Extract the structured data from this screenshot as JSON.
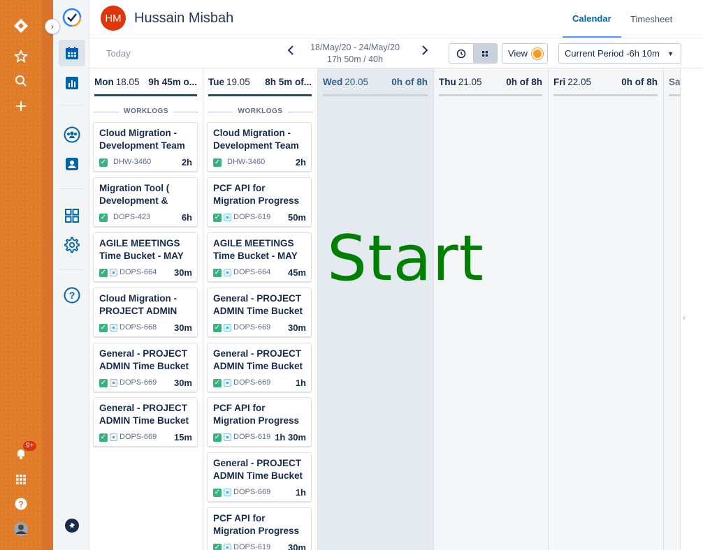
{
  "global_nav": {
    "notification_badge": "9+"
  },
  "header": {
    "avatar_initials": "HM",
    "user_name": "Hussain Misbah",
    "tabs": [
      "Calendar",
      "Timesheet"
    ]
  },
  "toolbar": {
    "today_label": "Today",
    "period_range": "18/May/20 - 24/May/20",
    "period_hours": "17h 50m / 40h",
    "view_label": "View",
    "current_period": "Current Period -6h 10m"
  },
  "worklogs_label": "WORKLOGS",
  "days": {
    "mon": {
      "name": "Mon",
      "date": "18.05",
      "hours": "9h 45m o..."
    },
    "tue": {
      "name": "Tue",
      "date": "19.05",
      "hours": "8h 5m of..."
    },
    "wed": {
      "name": "Wed",
      "date": "20.05",
      "hours": "0h of 8h"
    },
    "thu": {
      "name": "Thu",
      "date": "21.05",
      "hours": "0h of 8h"
    },
    "fri": {
      "name": "Fri",
      "date": "22.05",
      "hours": "0h of 8h"
    },
    "sat": {
      "name": "Sa"
    }
  },
  "mon_cards": [
    {
      "title": "Cloud Migration - Development Team",
      "key": "DHW-3460",
      "duration": "2h"
    },
    {
      "title": "Migration Tool ( Development &",
      "key": "DOPS-423",
      "duration": "6h"
    },
    {
      "title": "AGILE MEETINGS Time Bucket - MAY",
      "key": "DOPS-664",
      "duration": "30m"
    },
    {
      "title": "Cloud Migration - PROJECT ADMIN",
      "key": "DOPS-668",
      "duration": "30m"
    },
    {
      "title": "General - PROJECT ADMIN Time Bucket -",
      "key": "DOPS-669",
      "duration": "30m"
    },
    {
      "title": "General - PROJECT ADMIN Time Bucket -",
      "key": "DOPS-669",
      "duration": "15m"
    }
  ],
  "tue_cards": [
    {
      "title": "Cloud Migration - Development Team",
      "key": "DHW-3460",
      "duration": "2h"
    },
    {
      "title": "PCF API for Migration Progress",
      "key": "DOPS-619",
      "duration": "50m"
    },
    {
      "title": "AGILE MEETINGS Time Bucket - MAY",
      "key": "DOPS-664",
      "duration": "45m"
    },
    {
      "title": "General - PROJECT ADMIN Time Bucket -",
      "key": "DOPS-669",
      "duration": "30m"
    },
    {
      "title": "General - PROJECT ADMIN Time Bucket -",
      "key": "DOPS-669",
      "duration": "1h"
    },
    {
      "title": "PCF API for Migration Progress",
      "key": "DOPS-619",
      "duration": "1h 30m"
    },
    {
      "title": "General - PROJECT ADMIN Time Bucket -",
      "key": "DOPS-669",
      "duration": "1h"
    },
    {
      "title": "PCF API for Migration Progress",
      "key": "DOPS-619",
      "duration": "30m"
    }
  ],
  "overlay_text": "Start",
  "colors": {
    "jira_orange": "#e07b28",
    "accent_blue": "#0065a6",
    "done_green": "#36b37e",
    "overlay_green": "#008000"
  }
}
